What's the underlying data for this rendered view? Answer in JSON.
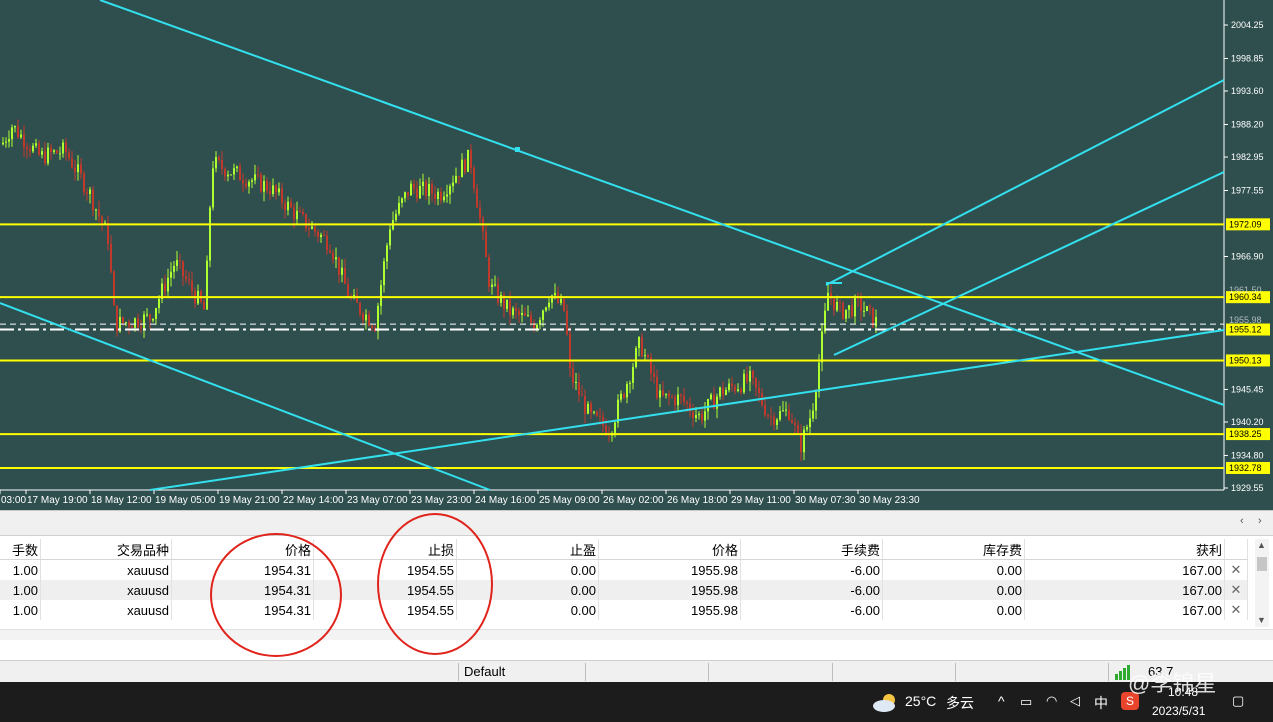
{
  "colors": {
    "background": "#2f4f4f",
    "bull_candle": "#adff2f",
    "bear_candle": "#c0392b",
    "trend_line": "#33e0ee",
    "level_line": "#ffff00",
    "annotation_circle": "#e0241c"
  },
  "chart": {
    "y_ticks": [
      "2004.25",
      "1998.85",
      "1993.60",
      "1988.20",
      "1982.95",
      "1977.55",
      "1966.90",
      "1945.45",
      "1940.20",
      "1934.80",
      "1929.55"
    ],
    "x_ticks": [
      "03:00",
      "17 May 19:00",
      "18 May 12:00",
      "19 May 05:00",
      "19 May 21:00",
      "22 May 14:00",
      "23 May 07:00",
      "23 May 23:00",
      "24 May 16:00",
      "25 May 09:00",
      "26 May 02:00",
      "26 May 18:00",
      "29 May 11:00",
      "30 May 07:30",
      "30 May 23:30"
    ],
    "level_labels": [
      "1972.09",
      "1960.34",
      "1955.12",
      "1950.13",
      "1938.25",
      "1932.78"
    ],
    "hidden_labels": [
      "1961.50",
      "1955.98"
    ]
  },
  "chart_data": {
    "type": "candlestick",
    "title": "",
    "ylim": [
      1928,
      2007
    ],
    "horizontal_lines": [
      1972.09,
      1960.34,
      1950.13,
      1938.25,
      1932.78
    ],
    "current_price_lines": [
      1955.98,
      1955.12
    ]
  },
  "terminal": {
    "columns": [
      "手数",
      "交易品种",
      "价格",
      "止损",
      "止盈",
      "价格",
      "手续费",
      "库存费",
      "获利"
    ],
    "rows": [
      {
        "lots": "1.00",
        "symbol": "xauusd",
        "price": "1954.31",
        "sl": "1954.55",
        "tp": "0.00",
        "current": "1955.98",
        "commission": "-6.00",
        "swap": "0.00",
        "profit": "167.00"
      },
      {
        "lots": "1.00",
        "symbol": "xauusd",
        "price": "1954.31",
        "sl": "1954.55",
        "tp": "0.00",
        "current": "1955.98",
        "commission": "-6.00",
        "swap": "0.00",
        "profit": "167.00"
      },
      {
        "lots": "1.00",
        "symbol": "xauusd",
        "price": "1954.31",
        "sl": "1954.55",
        "tp": "0.00",
        "current": "1955.98",
        "commission": "-6.00",
        "swap": "0.00",
        "profit": "167.00"
      }
    ],
    "close_glyph": "✕"
  },
  "statusbar": {
    "profile": "Default",
    "connection": "63.7"
  },
  "taskbar": {
    "weather_temp": "25°C",
    "weather_desc": "多云",
    "ime": "中",
    "time": "10:48",
    "date": "2023/5/31",
    "watermark": "@李锦星"
  }
}
